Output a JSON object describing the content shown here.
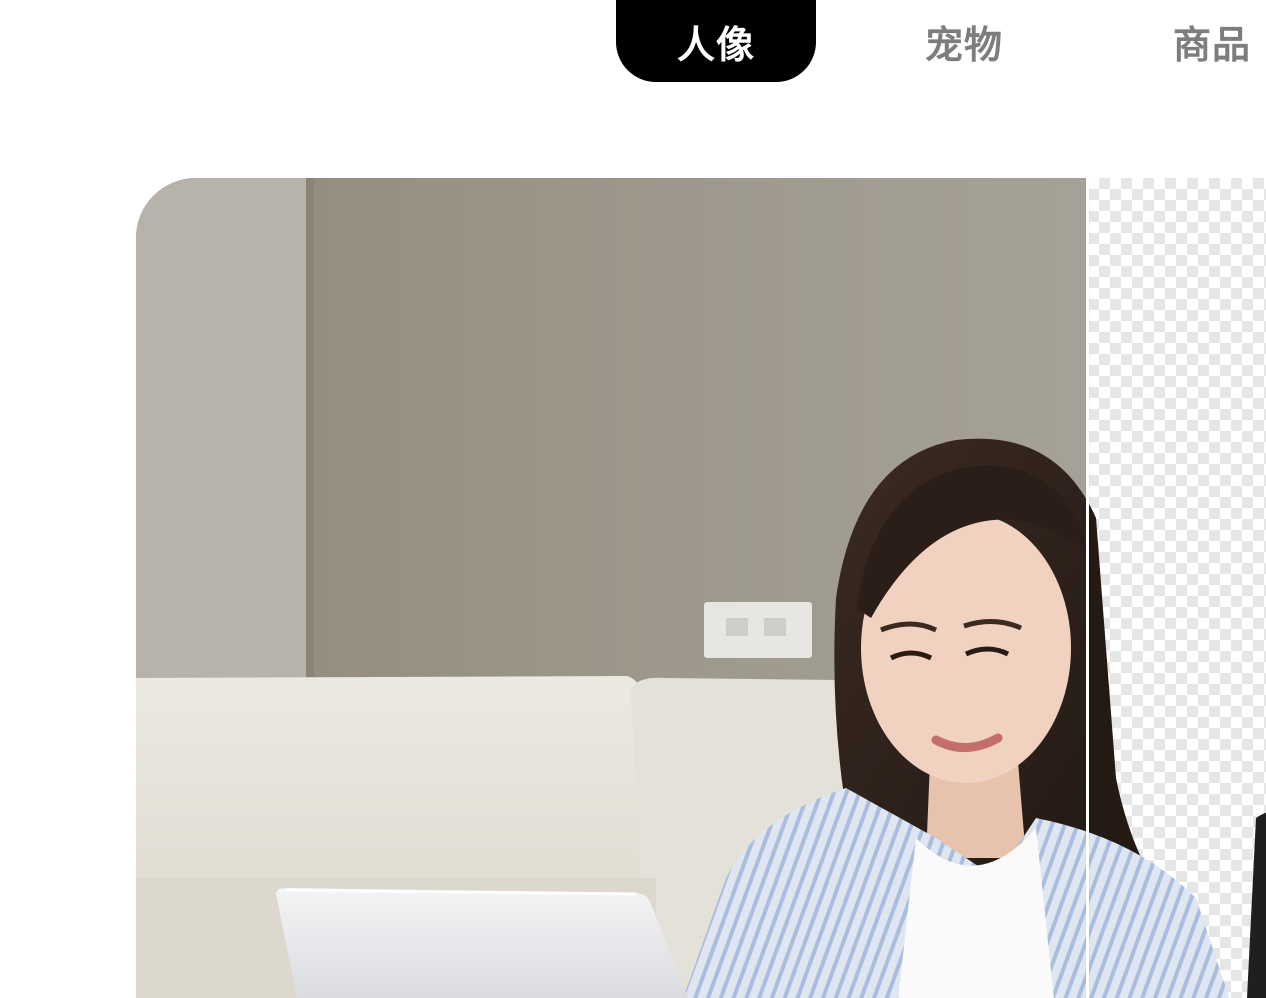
{
  "tabs": [
    {
      "label": "人像",
      "active": true
    },
    {
      "label": "宠物",
      "active": false
    },
    {
      "label": "商品",
      "active": false
    }
  ],
  "comparison": {
    "left_side": "original-photo",
    "right_side": "transparent-background-cutout"
  },
  "colors": {
    "active_tab_bg": "#000000",
    "active_tab_text": "#ffffff",
    "inactive_tab_text": "#7d7d7d",
    "wall": "#a39f96",
    "sofa": "#e6e3da",
    "shirt": "#c9d6e8"
  }
}
